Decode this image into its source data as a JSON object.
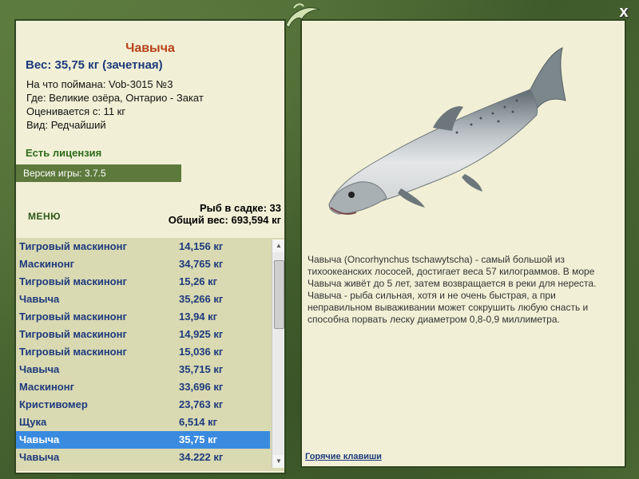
{
  "close_label": "x",
  "catch": {
    "species": "Чавыча",
    "weight": "Вес: 35,75 кг (зачетная)",
    "bait": "На что поймана: Vob-3015 №3",
    "location": "Где: Великие озёра, Онтарио - Закат",
    "price": "Оценивается с: 11 кг",
    "rarity": "Вид: Редчайший"
  },
  "license_text": "Есть лицензия",
  "version_text": "Версия игры: 3.7.5",
  "menu_label": "МЕНЮ",
  "keep_net": {
    "count_text": "Рыб в садке: 33",
    "total_weight_text": "Общий вес: 693,594 кг"
  },
  "fish_list": [
    {
      "name": "Тигровый маскинонг",
      "weight": "14,156 кг"
    },
    {
      "name": "Маскинонг",
      "weight": "34,765 кг"
    },
    {
      "name": "Тигровый маскинонг",
      "weight": "15,26 кг"
    },
    {
      "name": "Чавыча",
      "weight": "35,266 кг"
    },
    {
      "name": "Тигровый маскинонг",
      "weight": "13,94 кг"
    },
    {
      "name": "Тигровый маскинонг",
      "weight": "14,925 кг"
    },
    {
      "name": "Тигровый маскинонг",
      "weight": "15,036 кг"
    },
    {
      "name": "Чавыча",
      "weight": "35,715 кг"
    },
    {
      "name": "Маскинонг",
      "weight": "33,696 кг"
    },
    {
      "name": "Кристивомер",
      "weight": "23,763 кг"
    },
    {
      "name": "Щука",
      "weight": "6,514 кг"
    },
    {
      "name": "Чавыча",
      "weight": "35,75 кг"
    },
    {
      "name": "Чавыча",
      "weight": "34.222 кг"
    }
  ],
  "selected_index": 11,
  "description": "Чавыча (Oncorhynchus tschawytscha) - самый большой из тихоокеанских лососей, достигает веса 57 килограммов. В море Чавыча живёт до 5 лет, затем возвращается в реки для нереста. Чавыча - рыба сильная, хотя и не очень быстрая, а при неправильном вываживании может сокрушить любую снасть и способна порвать леску диаметром 0,8-0,9 миллиметра.",
  "hotkeys_label": "Горячие клавиши",
  "colors": {
    "species_title": "#b8431a",
    "accent_blue": "#1e3a7c",
    "license_green": "#2e6a1c",
    "selection": "#3a8be0",
    "panel_bg": "#f1f0d6",
    "frame_green": "#4e6b35"
  },
  "icons": {
    "logo": "fish-jumping-logo-icon",
    "close": "close-icon",
    "scroll_up": "triangle-up-icon",
    "scroll_down": "triangle-down-icon"
  }
}
